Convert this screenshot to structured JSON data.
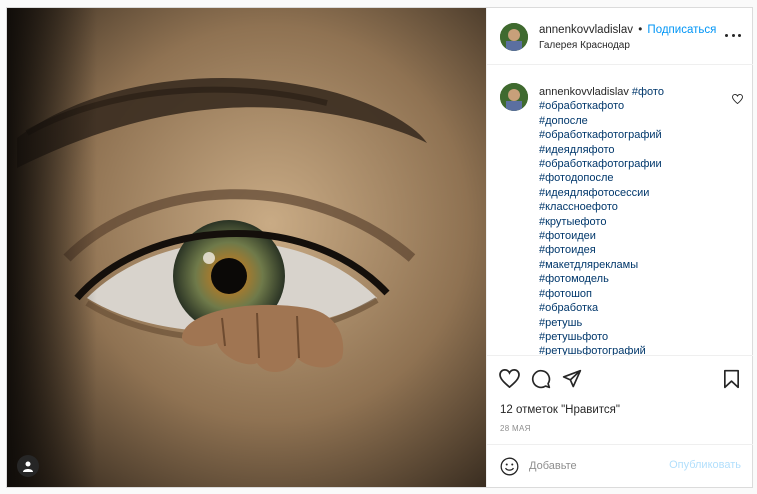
{
  "post": {
    "username": "annenkovvladislav",
    "separator": "•",
    "follow_label": "Подписаться",
    "location": "Галерея Краснодар"
  },
  "caption": {
    "username": "annenkovvladislav",
    "hashtags": [
      "#фото",
      "#обработкафото",
      "#допосле",
      "#обработкафотографий",
      "#идеядляфото",
      "#обработкафотографии",
      "#фотодопосле",
      "#идеядляфотосессии",
      "#классноефото",
      "#крутыефото",
      "#фотоидеи",
      "#фотоидея",
      "#макетдлярекламы",
      "#фотомодель",
      "#фотошоп",
      "#обработка",
      "#ретушь",
      "#ретушьфото",
      "#ретушьфотографий"
    ]
  },
  "engagement": {
    "likes_text": "12 отметок \"Нравится\"",
    "date": "28 МАЯ"
  },
  "comment_box": {
    "placeholder": "Добавьте",
    "publish_label": "Опубликовать"
  },
  "icons": {
    "like": "heart-icon",
    "comment": "comment-icon",
    "share": "share-icon",
    "save": "bookmark-icon",
    "more": "more-icon",
    "emoji": "emoji-icon",
    "user_tag": "user-tag-icon"
  },
  "colors": {
    "link_blue": "#0095f6",
    "hashtag": "#00376b",
    "publish_disabled": "#b2dffc",
    "text": "#262626",
    "muted": "#8e8e8e"
  }
}
